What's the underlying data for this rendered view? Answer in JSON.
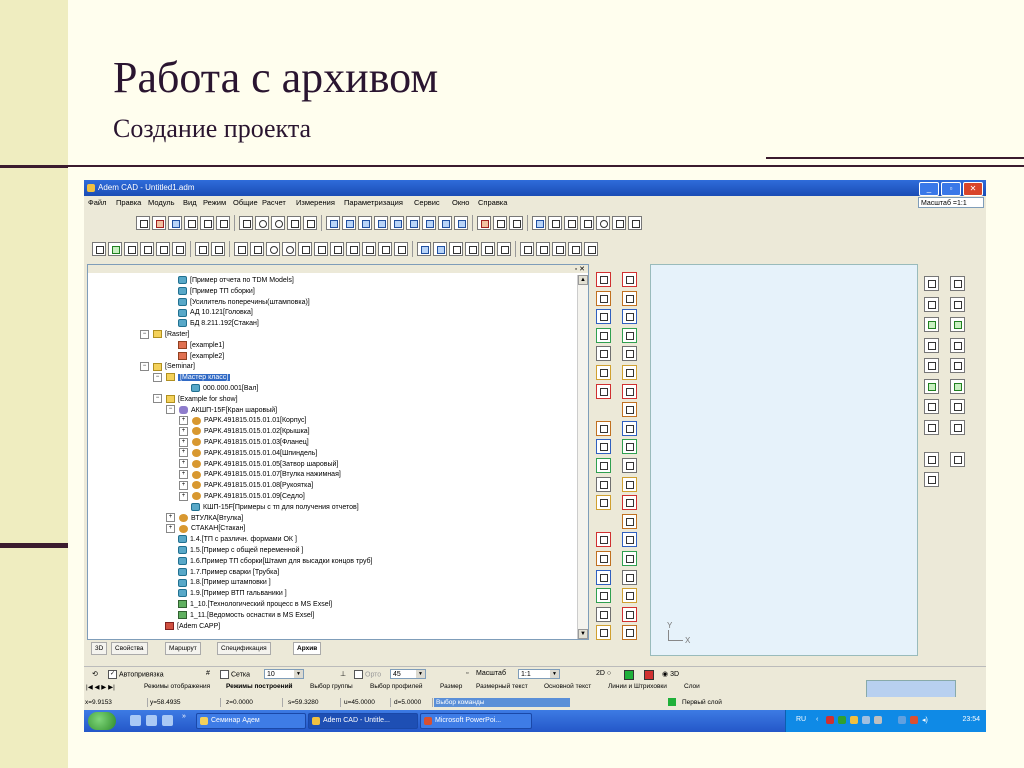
{
  "slide": {
    "title": "Работа с архивом",
    "subtitle": "Создание проекта"
  },
  "window": {
    "title": "Adem CAD - Untitled1.adm",
    "buttons": [
      "_",
      "▫",
      "✕"
    ],
    "menu": [
      "Файл",
      "Правка",
      "Модуль",
      "Вид",
      "Режим",
      "Общие",
      "Расчет",
      "Измерения",
      "Параметризация",
      "Сервис",
      "Окно",
      "Справка"
    ],
    "scale_label": "Масштаб =1:1"
  },
  "tree": {
    "close_label": "▫ ✕",
    "rows": [
      {
        "text": "[Пример отчета по TDM Models]",
        "icon": "part",
        "level": 6
      },
      {
        "text": "[Пример ТП сборки]",
        "icon": "part",
        "level": 6
      },
      {
        "text": "[Усилитель поперечины(штамповка)]",
        "icon": "part",
        "level": 6
      },
      {
        "text": "АД 10.121[Головка]",
        "icon": "part",
        "level": 6
      },
      {
        "text": "БД 8.211.192[Стакан]",
        "icon": "part",
        "level": 6
      },
      {
        "text": "[Raster]",
        "icon": "folder",
        "level": 4,
        "exp": "−"
      },
      {
        "text": "[example1]",
        "icon": "raster",
        "level": 6
      },
      {
        "text": "[example2]",
        "icon": "raster",
        "level": 6
      },
      {
        "text": "[Seminar]",
        "icon": "folder",
        "level": 4,
        "exp": "−"
      },
      {
        "text": "[Мастер класс]",
        "icon": "folder",
        "level": 5,
        "exp": "−",
        "selected": true
      },
      {
        "text": "000.000.001[Вал]",
        "icon": "part",
        "level": 7
      },
      {
        "text": "[Example for show]",
        "icon": "folder",
        "level": 5,
        "exp": "−"
      },
      {
        "text": "АКШП-15F[Кран шаровый]",
        "icon": "asm",
        "level": 6,
        "exp": "−"
      },
      {
        "text": "РАРК.491815.015.01.01[Корпус]",
        "icon": "detail",
        "level": 7,
        "exp": "+"
      },
      {
        "text": "РАРК.491815.015.01.02[Крышка]",
        "icon": "detail",
        "level": 7,
        "exp": "+"
      },
      {
        "text": "РАРК.491815.015.01.03[Фланец]",
        "icon": "detail",
        "level": 7,
        "exp": "+"
      },
      {
        "text": "РАРК.491815.015.01.04[Шпиндель]",
        "icon": "detail",
        "level": 7,
        "exp": "+"
      },
      {
        "text": "РАРК.491815.015.01.05[Затвор шаровый]",
        "icon": "detail",
        "level": 7,
        "exp": "+"
      },
      {
        "text": "РАРК.491815.015.01.07[Втулка нажимная]",
        "icon": "detail",
        "level": 7,
        "exp": "+"
      },
      {
        "text": "РАРК.491815.015.01.08[Рукоятка]",
        "icon": "detail",
        "level": 7,
        "exp": "+"
      },
      {
        "text": "РАРК.491815.015.01.09[Седло]",
        "icon": "detail",
        "level": 7,
        "exp": "+"
      },
      {
        "text": "КШП-15F[Примеры с тп для получения отчетов]",
        "icon": "part",
        "level": 7
      },
      {
        "text": "ВТУЛКА[Втулка]",
        "icon": "detail",
        "level": 6,
        "exp": "+"
      },
      {
        "text": "СТАКАН[Стакан]",
        "icon": "detail",
        "level": 6,
        "exp": "+"
      },
      {
        "text": "1.4.[ТП с различн. формами ОК ]",
        "icon": "part",
        "level": 6
      },
      {
        "text": "1.5.[Пример с общей переменной ]",
        "icon": "part",
        "level": 6
      },
      {
        "text": "1.6.Пример ТП сборки[Штамп для высадки концов труб]",
        "icon": "part",
        "level": 6
      },
      {
        "text": "1.7.Пример сварки [Трубка]",
        "icon": "part",
        "level": 6
      },
      {
        "text": "1.8.[Пример штамповки ]",
        "icon": "part",
        "level": 6
      },
      {
        "text": "1.9.[Пример ВТП гальваники ]",
        "icon": "part",
        "level": 6
      },
      {
        "text": "1_10.[Технологический процесс в MS Exsel]",
        "icon": "doc",
        "level": 6
      },
      {
        "text": "1_11.[Ведомость оснастки в MS Exsel]",
        "icon": "doc",
        "level": 6
      },
      {
        "text": "[Adem CAPP]",
        "icon": "capp",
        "level": 5
      }
    ]
  },
  "bottom_tabs": [
    "3D",
    "Свойства",
    "Маршрут",
    "Спецификация",
    "Архив"
  ],
  "viewport": {
    "axis_y": "Y",
    "axis_x": "X"
  },
  "props_bar": {
    "snap_label": "Автопривязка",
    "grid_label": "Сетка",
    "grid_value": "10",
    "ortho_label": "Орто",
    "ortho_value": "45",
    "scale_label": "Масштаб",
    "scale_value": "1:1",
    "mode_2d": "2D",
    "mode_3d": "3D"
  },
  "mode_tabs": {
    "nav": "|◀ ◀ ▶ ▶|",
    "items": [
      "Режимы отображения",
      "Режимы построений",
      "Выбор группы",
      "Выбор профилей",
      "Размер",
      "Размерный текст",
      "Основной текст",
      "Линии и Штриховки",
      "Слои"
    ],
    "active": "Режимы построений"
  },
  "coords": {
    "x": "x=9.9153",
    "y": "y=58.4935",
    "z": "z=0.0000",
    "s": "s=59.3280",
    "u": "u=45.0000",
    "d": "d=5.0000",
    "command": "Выбор команды",
    "layer": "Первый слой"
  },
  "taskbar": {
    "tasks": [
      "Семинар Адем",
      "Adem CAD - Untitle...",
      "Microsoft PowerPoi..."
    ],
    "lang": "RU",
    "clock": "23:54"
  },
  "colors": {
    "title_color": "#2a1530",
    "accent_bar": "#3b1b2e",
    "selection": "#316ac5",
    "layer_green": "#1fb03a"
  }
}
